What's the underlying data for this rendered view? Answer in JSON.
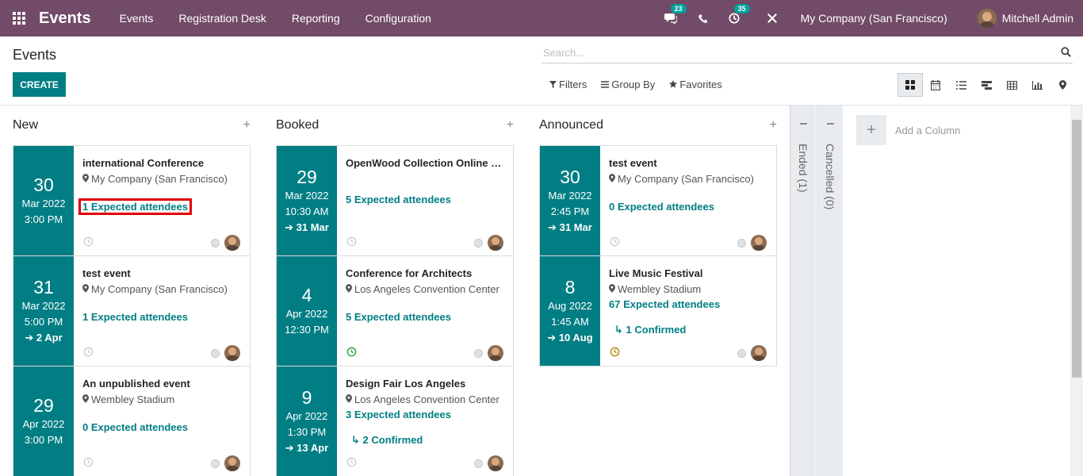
{
  "navbar": {
    "app_name": "Events",
    "menu": [
      "Events",
      "Registration Desk",
      "Reporting",
      "Configuration"
    ],
    "messages_count": "23",
    "activities_count": "35",
    "company": "My Company (San Francisco)",
    "user": "Mitchell Admin",
    "bg_color": "#714b67"
  },
  "control_panel": {
    "title": "Events",
    "create_label": "CREATE",
    "search_placeholder": "Search...",
    "filters_label": "Filters",
    "groupby_label": "Group By",
    "favorites_label": "Favorites",
    "views": [
      "kanban",
      "calendar",
      "list",
      "gantt",
      "pivot",
      "graph",
      "map"
    ],
    "active_view": "kanban"
  },
  "accent_color": "#017e84",
  "columns": [
    {
      "title": "New",
      "cards": [
        {
          "day": "30",
          "month": "Mar 2022",
          "time": "3:00 PM",
          "end": "",
          "name": "international Conference",
          "location": "My Company (San Francisco)",
          "attendees": "1 Expected attendees",
          "confirmed": "",
          "highlighted": true,
          "activity": "none"
        },
        {
          "day": "31",
          "month": "Mar 2022",
          "time": "5:00 PM",
          "end": "2 Apr",
          "name": "test event",
          "location": "My Company (San Francisco)",
          "attendees": "1 Expected attendees",
          "confirmed": "",
          "highlighted": false,
          "activity": "none"
        },
        {
          "day": "29",
          "month": "Apr 2022",
          "time": "3:00 PM",
          "end": "",
          "name": "An unpublished event",
          "location": "Wembley Stadium",
          "attendees": "0 Expected attendees",
          "confirmed": "",
          "highlighted": false,
          "activity": "none"
        }
      ]
    },
    {
      "title": "Booked",
      "cards": [
        {
          "day": "29",
          "month": "Mar 2022",
          "time": "10:30 AM",
          "end": "31 Mar",
          "name": "OpenWood Collection Online Re...",
          "location": "",
          "attendees": "5 Expected attendees",
          "confirmed": "",
          "highlighted": false,
          "activity": "none"
        },
        {
          "day": "4",
          "month": "Apr 2022",
          "time": "12:30 PM",
          "end": "",
          "name": "Conference for Architects",
          "location": "Los Angeles Convention Center",
          "attendees": "5 Expected attendees",
          "confirmed": "",
          "highlighted": false,
          "activity": "planned"
        },
        {
          "day": "9",
          "month": "Apr 2022",
          "time": "1:30 PM",
          "end": "13 Apr",
          "name": "Design Fair Los Angeles",
          "location": "Los Angeles Convention Center",
          "attendees": "3 Expected attendees",
          "confirmed": "2 Confirmed",
          "highlighted": false,
          "activity": "none"
        }
      ]
    },
    {
      "title": "Announced",
      "cards": [
        {
          "day": "30",
          "month": "Mar 2022",
          "time": "2:45 PM",
          "end": "31 Mar",
          "name": "test event",
          "location": "My Company (San Francisco)",
          "attendees": "0 Expected attendees",
          "confirmed": "",
          "highlighted": false,
          "activity": "none"
        },
        {
          "day": "8",
          "month": "Aug 2022",
          "time": "1:45 AM",
          "end": "10 Aug",
          "name": "Live Music Festival",
          "location": "Wembley Stadium",
          "attendees": "67 Expected attendees",
          "confirmed": "1 Confirmed",
          "highlighted": false,
          "activity": "warning"
        }
      ]
    }
  ],
  "folded_columns": [
    "Ended (1)",
    "Cancelled (0)"
  ],
  "add_column_label": "Add a Column"
}
